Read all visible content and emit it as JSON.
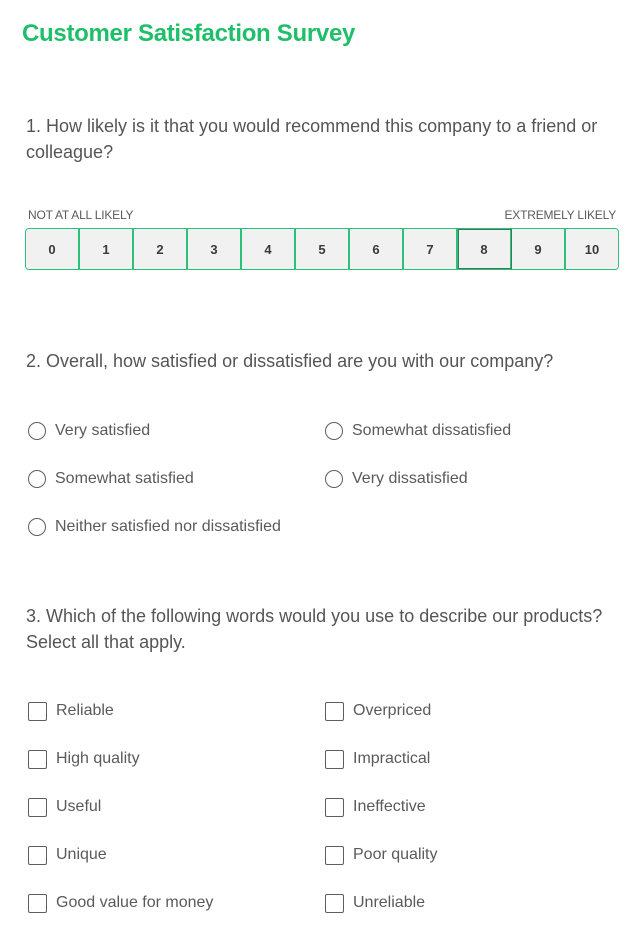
{
  "survey": {
    "title": "Customer Satisfaction Survey",
    "accent_color": "#1fbf6a"
  },
  "q1": {
    "text": "1. How likely is it that you would recommend this company to a friend or colleague?",
    "low_label": "NOT AT ALL LIKELY",
    "high_label": "EXTREMELY LIKELY",
    "scale": [
      "0",
      "1",
      "2",
      "3",
      "4",
      "5",
      "6",
      "7",
      "8",
      "9",
      "10"
    ],
    "hovered": "8"
  },
  "q2": {
    "text": "2. Overall, how satisfied or dissatisfied are you with our company?",
    "options": [
      {
        "label": "Very satisfied",
        "checked": false
      },
      {
        "label": "Somewhat dissatisfied",
        "checked": false
      },
      {
        "label": "Somewhat satisfied",
        "checked": false
      },
      {
        "label": "Very dissatisfied",
        "checked": false
      },
      {
        "label": "Neither satisfied nor dissatisfied",
        "checked": false
      }
    ]
  },
  "q3": {
    "text": "3. Which of the following words would you use to describe our products? Select all that apply.",
    "options": [
      {
        "label": "Reliable",
        "checked": false
      },
      {
        "label": "Overpriced",
        "checked": false
      },
      {
        "label": "High quality",
        "checked": false
      },
      {
        "label": "Impractical",
        "checked": false
      },
      {
        "label": "Useful",
        "checked": false
      },
      {
        "label": "Ineffective",
        "checked": false
      },
      {
        "label": "Unique",
        "checked": false
      },
      {
        "label": "Poor quality",
        "checked": false
      },
      {
        "label": "Good value for money",
        "checked": false
      },
      {
        "label": "Unreliable",
        "checked": false
      }
    ]
  }
}
